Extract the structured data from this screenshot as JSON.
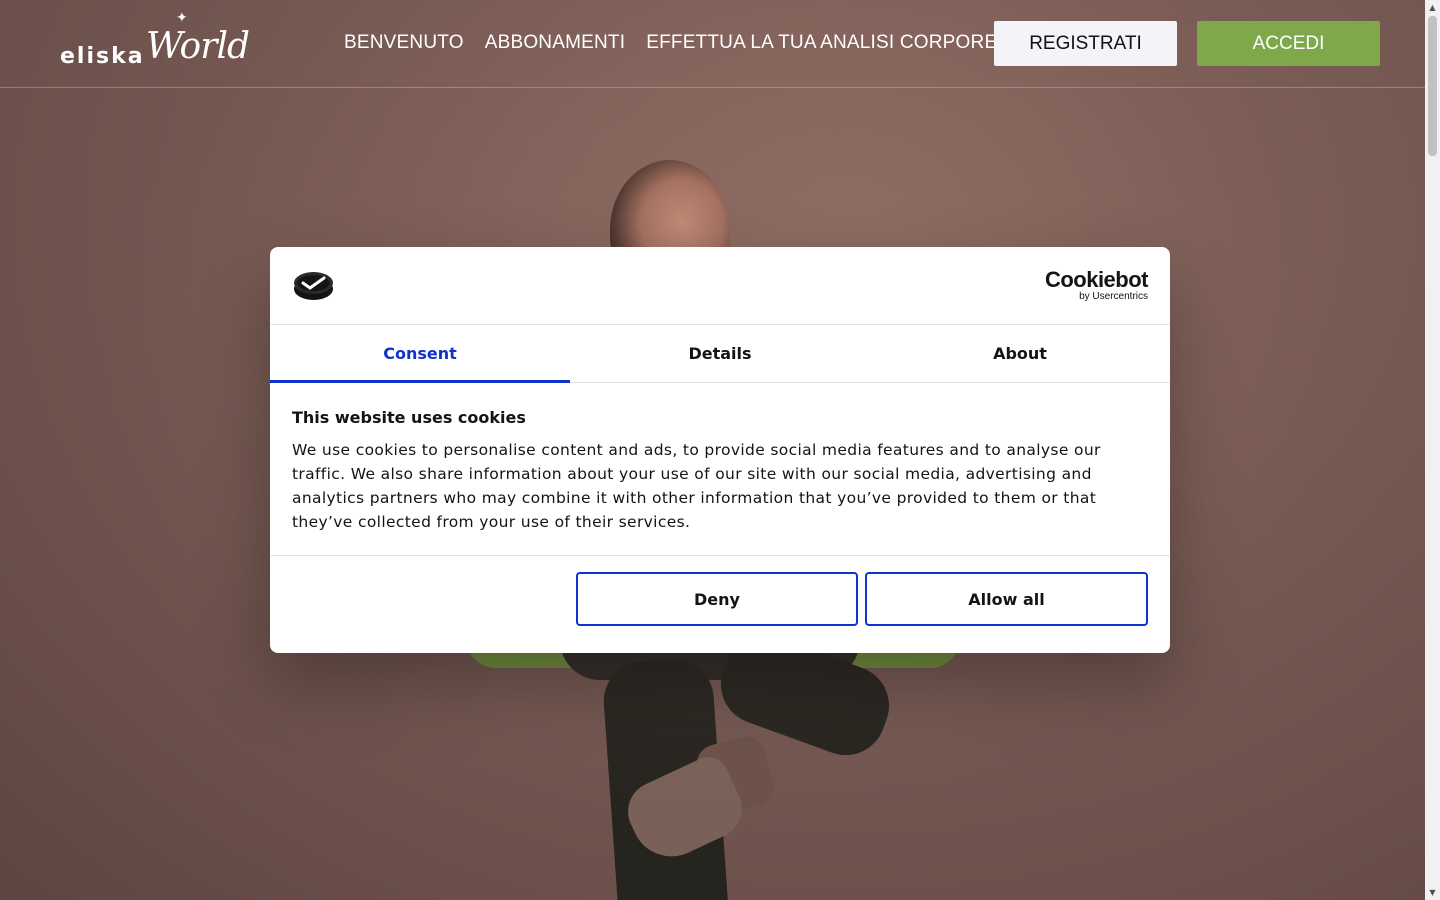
{
  "site": {
    "logo_part1": "eliska",
    "logo_part2": "World",
    "nav": [
      "BENVENUTO",
      "ABBONAMENTI",
      "EFFETTUA LA TUA ANALISI CORPOREA"
    ],
    "register_label": "REGISTRATI",
    "login_label": "ACCEDI",
    "colors": {
      "accent_green": "#7ea84a"
    }
  },
  "cookie_dialog": {
    "brand_title": "Cookiebot",
    "brand_subtitle": "by Usercentrics",
    "tabs": [
      "Consent",
      "Details",
      "About"
    ],
    "active_tab": "Consent",
    "heading": "This website uses cookies",
    "body": "We use cookies to personalise content and ads, to provide social media features and to analyse our traffic. We also share information about your use of our site with our social media, advertising and analytics partners who may combine it with other information that you’ve provided to them or that they’ve collected from your use of their services.",
    "deny_label": "Deny",
    "allow_label": "Allow all",
    "colors": {
      "tab_active": "#1032cf",
      "button_border": "#1032cf"
    }
  }
}
